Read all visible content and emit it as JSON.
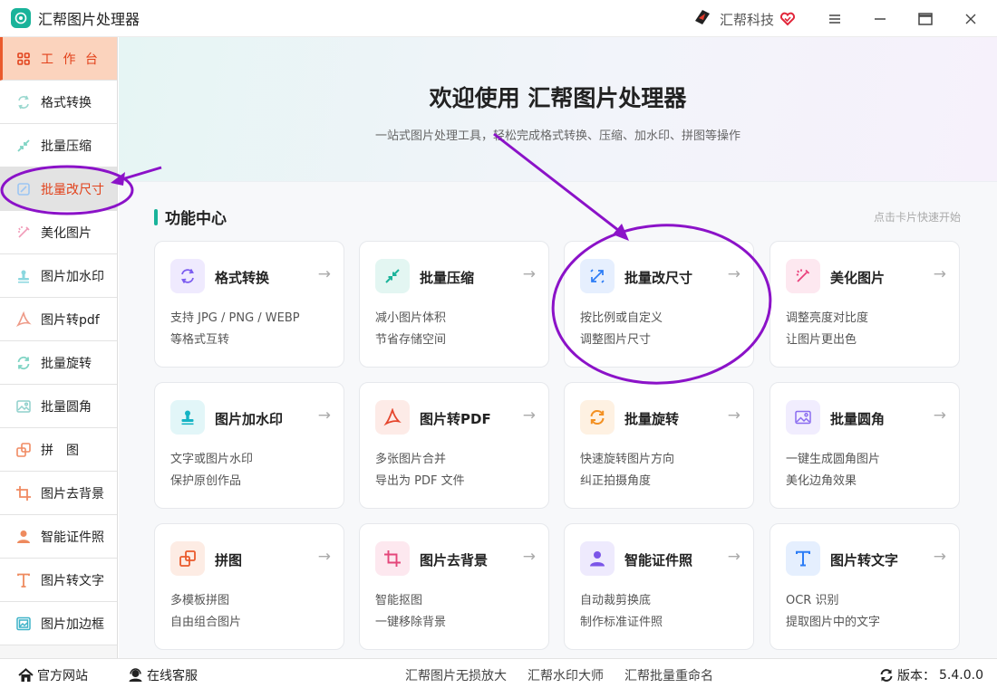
{
  "app": {
    "title": "汇帮图片处理器",
    "brand": "汇帮科技"
  },
  "window_controls": [
    "menu",
    "minimize",
    "maximize",
    "close"
  ],
  "sidebar": {
    "items": [
      {
        "label": "工 作 台",
        "icon": "grid-icon",
        "state": "active"
      },
      {
        "label": "格式转换",
        "icon": "convert-icon"
      },
      {
        "label": "批量压缩",
        "icon": "compress-icon"
      },
      {
        "label": "批量改尺寸",
        "icon": "resize-icon",
        "state": "selected"
      },
      {
        "label": "美化图片",
        "icon": "beautify-icon"
      },
      {
        "label": "图片加水印",
        "icon": "stamp-icon"
      },
      {
        "label": "图片转pdf",
        "icon": "pdf-icon"
      },
      {
        "label": "批量旋转",
        "icon": "rotate-icon"
      },
      {
        "label": "批量圆角",
        "icon": "image-icon"
      },
      {
        "label": "拼　图",
        "icon": "collage-icon"
      },
      {
        "label": "图片去背景",
        "icon": "crop-icon"
      },
      {
        "label": "智能证件照",
        "icon": "person-icon"
      },
      {
        "label": "图片转文字",
        "icon": "text-icon"
      },
      {
        "label": "图片加边框",
        "icon": "frame-icon"
      }
    ]
  },
  "hero": {
    "title": "欢迎使用 汇帮图片处理器",
    "subtitle": "一站式图片处理工具，轻松完成格式转换、压缩、加水印、拼图等操作"
  },
  "section": {
    "title": "功能中心",
    "hint": "点击卡片快速开始"
  },
  "cards": [
    {
      "title": "格式转换",
      "line1": "支持 JPG / PNG / WEBP",
      "line2": "等格式互转",
      "icon": "convert-icon",
      "color": "#7b5cf0",
      "bg": "#efeafe"
    },
    {
      "title": "批量压缩",
      "line1": "减小图片体积",
      "line2": "节省存储空间",
      "icon": "compress-icon",
      "color": "#19b39a",
      "bg": "#e3f6f2"
    },
    {
      "title": "批量改尺寸",
      "line1": "按比例或自定义",
      "line2": "调整图片尺寸",
      "icon": "resize-icon",
      "color": "#2b7cf6",
      "bg": "#e6effe"
    },
    {
      "title": "美化图片",
      "line1": "调整亮度对比度",
      "line2": "让图片更出色",
      "icon": "beautify-icon",
      "color": "#ea3f7b",
      "bg": "#fde8f0"
    },
    {
      "title": "图片加水印",
      "line1": "文字或图片水印",
      "line2": "保护原创作品",
      "icon": "stamp-icon",
      "color": "#16b4c4",
      "bg": "#e2f6f8"
    },
    {
      "title": "图片转PDF",
      "line1": "多张图片合并",
      "line2": "导出为 PDF 文件",
      "icon": "pdf-icon",
      "color": "#e5462d",
      "bg": "#fdebe7"
    },
    {
      "title": "批量旋转",
      "line1": "快速旋转图片方向",
      "line2": "纠正拍摄角度",
      "icon": "rotate-icon",
      "color": "#f39123",
      "bg": "#fef1e2"
    },
    {
      "title": "批量圆角",
      "line1": "一键生成圆角图片",
      "line2": "美化边角效果",
      "icon": "image-icon",
      "color": "#8a6cf0",
      "bg": "#f1edfe"
    },
    {
      "title": "拼图",
      "line1": "多模板拼图",
      "line2": "自由组合图片",
      "icon": "collage-icon",
      "color": "#ea5a2c",
      "bg": "#fdece4"
    },
    {
      "title": "图片去背景",
      "line1": "智能抠图",
      "line2": "一键移除背景",
      "icon": "crop-icon",
      "color": "#e4467a",
      "bg": "#fde8ef"
    },
    {
      "title": "智能证件照",
      "line1": "自动裁剪换底",
      "line2": "制作标准证件照",
      "icon": "person-icon",
      "color": "#7b55e8",
      "bg": "#eeeafd"
    },
    {
      "title": "图片转文字",
      "line1": "OCR 识别",
      "line2": "提取图片中的文字",
      "icon": "text-icon",
      "color": "#2b7cf6",
      "bg": "#e5effe"
    }
  ],
  "statusbar": {
    "website": "官方网站",
    "support": "在线客服",
    "links": [
      "汇帮图片无损放大",
      "汇帮水印大师",
      "汇帮批量重命名"
    ],
    "version_label": "版本：",
    "version": "5.4.0.0"
  },
  "colors": {
    "accent": "#19b39a",
    "active_bg": "#fbd3bd",
    "active_text": "#e2421b",
    "annotation": "#8b12c8"
  }
}
